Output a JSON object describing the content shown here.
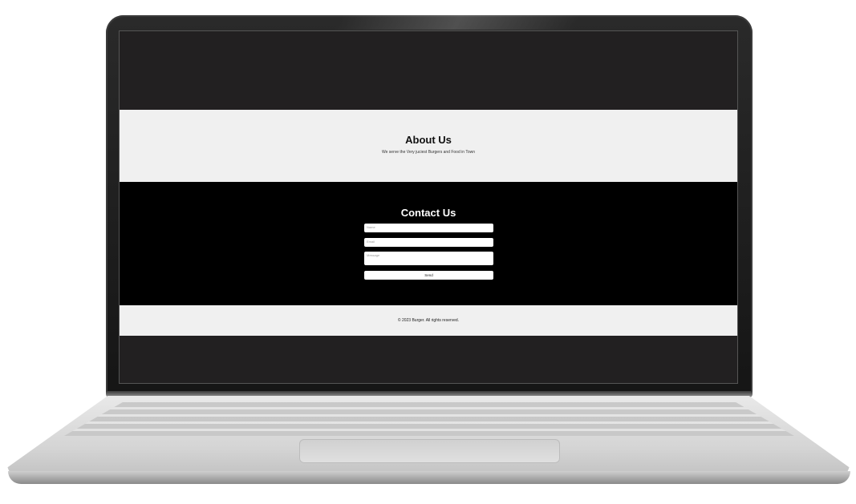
{
  "about": {
    "heading": "About Us",
    "text": "We serve the Very juciest Burgers and Food in Town"
  },
  "contact": {
    "heading": "Contact Us",
    "name_placeholder": "Name",
    "email_placeholder": "Email",
    "message_placeholder": "Message",
    "send_label": "Send"
  },
  "footer": {
    "copyright": "© 2023 Burger. All rights reserved."
  },
  "colors": {
    "screen_bg": "#222021",
    "section_light": "#f0f0f0",
    "section_dark": "#000000"
  }
}
